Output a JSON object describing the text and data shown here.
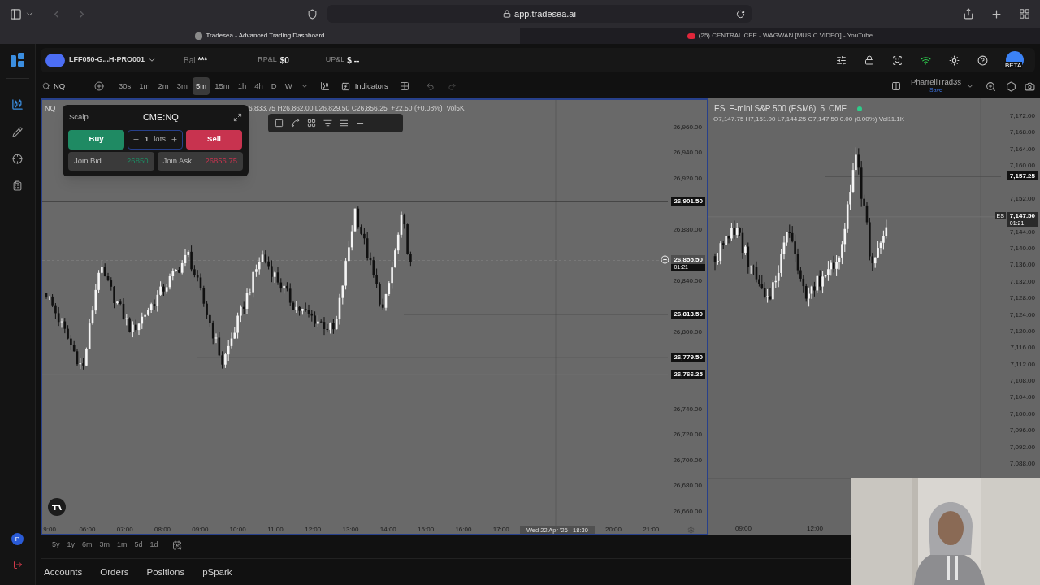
{
  "browser": {
    "address": "app.tradesea.ai",
    "tabs": [
      {
        "title": "Tradesea - Advanced Trading Dashboard",
        "selected": true
      },
      {
        "title": "(25) CENTRAL CEE - WAGWAN [MUSIC VIDEO] - YouTube",
        "selected": false
      }
    ]
  },
  "sidebar": {
    "user_initial": "P"
  },
  "account_bar": {
    "account": "LFF050-G...H-PRO001",
    "balance_label": "Bal",
    "balance_value": "***",
    "rpnl_label": "RP&L",
    "rpnl_value": "$0",
    "upnl_label": "UP&L",
    "upnl_value": "$ --",
    "avatar_badge": "BETA"
  },
  "toolbar": {
    "symbol": "NQ",
    "timeframes": [
      {
        "label": "30s",
        "selected": false
      },
      {
        "label": "1m",
        "selected": false
      },
      {
        "label": "2m",
        "selected": false
      },
      {
        "label": "3m",
        "selected": false
      },
      {
        "label": "5m",
        "selected": true
      },
      {
        "label": "15m",
        "selected": false
      },
      {
        "label": "1h",
        "selected": false
      },
      {
        "label": "4h",
        "selected": false
      },
      {
        "label": "D",
        "selected": false
      },
      {
        "label": "W",
        "selected": false
      }
    ],
    "indicators": "Indicators",
    "layout_name": "PharrellTrad3s",
    "layout_status": "Save"
  },
  "main_chart": {
    "symbol": "NQ",
    "ohlc": "6,833.75 H26,862.00 L26,829.50 C26,856.25  +22.50 (+0.08%)  Vol5K",
    "price_labels": [
      "26,960.00",
      "26,940.00",
      "26,920.00",
      "26,880.00",
      "26,840.00",
      "26,800.00",
      "26,740.00",
      "26,720.00",
      "26,700.00",
      "26,680.00",
      "26,660.00"
    ],
    "price_tags": [
      {
        "kind": "level",
        "text": "26,901.50"
      },
      {
        "kind": "crosshair",
        "text": "26,855.50",
        "sub": "01:21"
      },
      {
        "kind": "level",
        "text": "26,813.50"
      },
      {
        "kind": "level",
        "text": "26,779.50"
      },
      {
        "kind": "level",
        "text": "26,766.25"
      }
    ],
    "time_axis": [
      {
        "kind": "tick",
        "text": "9:00"
      },
      {
        "kind": "tick",
        "text": "06:00"
      },
      {
        "kind": "tick",
        "text": "07:00"
      },
      {
        "kind": "tick",
        "text": "08:00"
      },
      {
        "kind": "tick",
        "text": "09:00"
      },
      {
        "kind": "tick",
        "text": "10:00"
      },
      {
        "kind": "tick",
        "text": "11:00"
      },
      {
        "kind": "tick",
        "text": "12:00"
      },
      {
        "kind": "tick",
        "text": "13:00"
      },
      {
        "kind": "tick",
        "text": "14:00"
      },
      {
        "kind": "tick",
        "text": "15:00"
      },
      {
        "kind": "tick",
        "text": "16:00"
      },
      {
        "kind": "tick",
        "text": "17:00"
      },
      {
        "kind": "crosshair",
        "text": "Wed 22 Apr '26   18:30"
      },
      {
        "kind": "tick",
        "text": "20:00"
      },
      {
        "kind": "tick",
        "text": "21:00"
      }
    ]
  },
  "order_panel": {
    "mode": "Scalp",
    "symbol": "CME:NQ",
    "buy": "Buy",
    "quantity": "1",
    "unit": "lots",
    "sell": "Sell",
    "join_bid": "Join Bid",
    "bid": "26850",
    "join_ask": "Join Ask",
    "ask": "26856.75"
  },
  "second_chart": {
    "symbol": "ES",
    "name": "E-mini S&P 500 (ESM6)",
    "interval": "5",
    "exchange": "CME",
    "ohlc": "O7,147.75 H7,151.00 L7,144.25 C7,147.50 0.00 (0.00%) Vol11.1K",
    "price_labels": [
      "7,172.00",
      "7,168.00",
      "7,164.00",
      "7,160.00",
      "7,152.00",
      "7,144.00",
      "7,140.00",
      "7,136.00",
      "7,132.00",
      "7,128.00",
      "7,124.00",
      "7,120.00",
      "7,116.00",
      "7,112.00",
      "7,108.00",
      "7,104.00",
      "7,100.00",
      "7,096.00",
      "7,092.00",
      "7,088.00"
    ],
    "price_tags": [
      {
        "kind": "level",
        "text": "7,157.25"
      },
      {
        "kind": "last",
        "text": "7,147.50",
        "sub": "01:21",
        "badge": "ES"
      }
    ],
    "time_axis": [
      "09:00",
      "12:00"
    ]
  },
  "range_buttons": [
    "5y",
    "1y",
    "6m",
    "3m",
    "1m",
    "5d",
    "1d"
  ],
  "bottom_tabs": [
    "Accounts",
    "Orders",
    "Positions",
    "pSpark"
  ],
  "webcam": {
    "kind": "picture"
  }
}
